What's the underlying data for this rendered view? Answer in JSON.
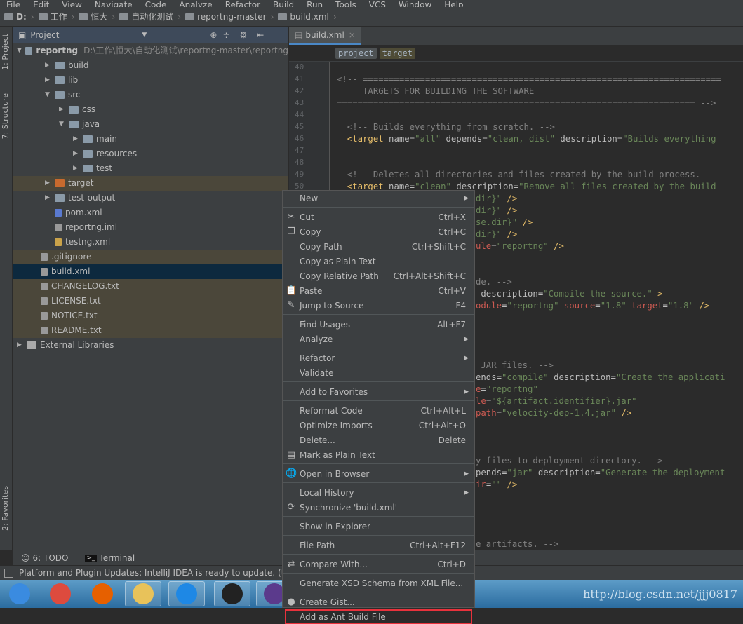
{
  "menubar": [
    "File",
    "Edit",
    "View",
    "Navigate",
    "Code",
    "Analyze",
    "Refactor",
    "Build",
    "Run",
    "Tools",
    "VCS",
    "Window",
    "Help"
  ],
  "breadcrumbs": [
    "D:",
    "工作",
    "恒大",
    "自动化测试",
    "reportng-master",
    "build.xml"
  ],
  "left_strip": {
    "project": "1: Project",
    "structure": "7: Structure",
    "favorites": "2: Favorites"
  },
  "project_panel": {
    "title": "Project",
    "root": {
      "name": "reportng",
      "path": "D:\\工作\\恒大\\自动化测试\\reportng-master\\reportng"
    },
    "items": [
      {
        "name": "build",
        "depth": 1,
        "type": "folder",
        "expanded": false
      },
      {
        "name": "lib",
        "depth": 1,
        "type": "folder",
        "expanded": false
      },
      {
        "name": "src",
        "depth": 1,
        "type": "folder",
        "expanded": true
      },
      {
        "name": "css",
        "depth": 2,
        "type": "folder",
        "expanded": false
      },
      {
        "name": "java",
        "depth": 2,
        "type": "folder",
        "expanded": true
      },
      {
        "name": "main",
        "depth": 3,
        "type": "folder",
        "expanded": false
      },
      {
        "name": "resources",
        "depth": 3,
        "type": "folder",
        "expanded": false
      },
      {
        "name": "test",
        "depth": 3,
        "type": "folder",
        "expanded": false
      },
      {
        "name": "target",
        "depth": 1,
        "type": "excluded",
        "expanded": false
      },
      {
        "name": "test-output",
        "depth": 1,
        "type": "folder",
        "expanded": false
      },
      {
        "name": "pom.xml",
        "depth": 1,
        "type": "maven"
      },
      {
        "name": "reportng.iml",
        "depth": 1,
        "type": "file"
      },
      {
        "name": "testng.xml",
        "depth": 1,
        "type": "xml"
      },
      {
        "name": ".gitignore",
        "depth": 0,
        "type": "file",
        "ignored": true
      },
      {
        "name": "build.xml",
        "depth": 0,
        "type": "file",
        "selected": true
      },
      {
        "name": "CHANGELOG.txt",
        "depth": 0,
        "type": "file",
        "ignored": true
      },
      {
        "name": "LICENSE.txt",
        "depth": 0,
        "type": "file",
        "ignored": true
      },
      {
        "name": "NOTICE.txt",
        "depth": 0,
        "type": "file",
        "ignored": true
      },
      {
        "name": "README.txt",
        "depth": 0,
        "type": "file",
        "ignored": true
      },
      {
        "name": "External Libraries",
        "depth": -1,
        "type": "library",
        "expanded": false
      }
    ]
  },
  "editor": {
    "tab": "build.xml",
    "crumbs": [
      "project",
      "target"
    ],
    "line_numbers": [
      "40",
      "41",
      "42",
      "43",
      "44",
      "45",
      "46",
      "47",
      "48",
      "49",
      "50"
    ],
    "lines": [
      [],
      [
        [
          "c",
          "<!-- ====================================================================="
        ]
      ],
      [
        [
          "c",
          "     TARGETS FOR BUILDING THE SOFTWARE"
        ]
      ],
      [
        [
          "c",
          "===================================================================== -->"
        ]
      ],
      [],
      [
        [
          "c",
          "  <!-- Builds everything from scratch. -->"
        ]
      ],
      [
        [
          "t",
          "  <target "
        ],
        [
          "a",
          "name="
        ],
        [
          "v",
          "\"all\" "
        ],
        [
          "a",
          "depends="
        ],
        [
          "v",
          "\"clean, dist\" "
        ],
        [
          "a",
          "description="
        ],
        [
          "v",
          "\"Builds everything"
        ]
      ],
      [],
      [],
      [
        [
          "c",
          "  <!-- Deletes all directories and files created by the build process. -"
        ]
      ],
      [
        [
          "t",
          "  <target "
        ],
        [
          "a",
          "name="
        ],
        [
          "v",
          "\"clean\" "
        ],
        [
          "a",
          "description="
        ],
        [
          "v",
          "\"Remove all files created by the build"
        ]
      ]
    ],
    "hidden_fragments": [
      [
        [
          "v",
          "dir}\" "
        ],
        [
          "t",
          "/>"
        ]
      ],
      [
        [
          "v",
          "dir}\" "
        ],
        [
          "t",
          "/>"
        ]
      ],
      [
        [
          "v",
          "se.dir}\" "
        ],
        [
          "t",
          "/>"
        ]
      ],
      [
        [
          "v",
          "dir}\" "
        ],
        [
          "t",
          "/>"
        ]
      ],
      [
        [
          "e",
          "ule"
        ],
        [
          "a",
          "="
        ],
        [
          "v",
          "\"reportng\" "
        ],
        [
          "t",
          "/>"
        ]
      ],
      [],
      [],
      [
        [
          "c",
          "de. -->"
        ]
      ],
      [
        [
          "a",
          " description="
        ],
        [
          "v",
          "\"Compile the source.\" "
        ],
        [
          "t",
          ">"
        ]
      ],
      [
        [
          "e",
          "odule"
        ],
        [
          "a",
          "="
        ],
        [
          "v",
          "\"reportng\" "
        ],
        [
          "e",
          "source"
        ],
        [
          "a",
          "="
        ],
        [
          "v",
          "\"1.8\" "
        ],
        [
          "e",
          "target"
        ],
        [
          "a",
          "="
        ],
        [
          "v",
          "\"1.8\" "
        ],
        [
          "t",
          "/>"
        ]
      ],
      [],
      [],
      [],
      [],
      [
        [
          "c",
          " JAR files. -->"
        ]
      ],
      [
        [
          "a",
          "ends="
        ],
        [
          "v",
          "\"compile\" "
        ],
        [
          "a",
          "description="
        ],
        [
          "v",
          "\"Create the applicati"
        ]
      ],
      [
        [
          "e",
          "e"
        ],
        [
          "a",
          "="
        ],
        [
          "v",
          "\"reportng\""
        ]
      ],
      [
        [
          "e",
          "le"
        ],
        [
          "a",
          "="
        ],
        [
          "v",
          "\"${artifact.identifier}.jar\""
        ]
      ],
      [
        [
          "e",
          "path"
        ],
        [
          "a",
          "="
        ],
        [
          "v",
          "\"velocity-dep-1.4.jar\" "
        ],
        [
          "t",
          "/>"
        ]
      ],
      [],
      [],
      [],
      [
        [
          "c",
          "y files to deployment directory. -->"
        ]
      ],
      [
        [
          "a",
          "pends="
        ],
        [
          "v",
          "\"jar\" "
        ],
        [
          "a",
          "description="
        ],
        [
          "v",
          "\"Generate the deployment"
        ]
      ],
      [
        [
          "e",
          "ir"
        ],
        [
          "a",
          "="
        ],
        [
          "v",
          "\"\" "
        ],
        [
          "t",
          "/>"
        ]
      ],
      [],
      [],
      [],
      [],
      [
        [
          "c",
          "e artifacts. -->"
        ]
      ]
    ]
  },
  "context_menu": [
    {
      "label": "New",
      "submenu": true
    },
    {
      "sep": true
    },
    {
      "label": "Cut",
      "shortcut": "Ctrl+X",
      "icon": "scissors-icon",
      "glyph": "✂"
    },
    {
      "label": "Copy",
      "shortcut": "Ctrl+C",
      "icon": "copy-icon",
      "glyph": "❐"
    },
    {
      "label": "Copy Path",
      "shortcut": "Ctrl+Shift+C"
    },
    {
      "label": "Copy as Plain Text"
    },
    {
      "label": "Copy Relative Path",
      "shortcut": "Ctrl+Alt+Shift+C"
    },
    {
      "label": "Paste",
      "shortcut": "Ctrl+V",
      "icon": "paste-icon",
      "glyph": "📋"
    },
    {
      "label": "Jump to Source",
      "shortcut": "F4",
      "icon": "jump-to-source-icon",
      "glyph": "✎"
    },
    {
      "sep": true
    },
    {
      "label": "Find Usages",
      "shortcut": "Alt+F7"
    },
    {
      "label": "Analyze",
      "submenu": true
    },
    {
      "sep": true
    },
    {
      "label": "Refactor",
      "submenu": true
    },
    {
      "label": "Validate"
    },
    {
      "sep": true
    },
    {
      "label": "Add to Favorites",
      "submenu": true
    },
    {
      "sep": true
    },
    {
      "label": "Reformat Code",
      "shortcut": "Ctrl+Alt+L"
    },
    {
      "label": "Optimize Imports",
      "shortcut": "Ctrl+Alt+O"
    },
    {
      "label": "Delete...",
      "shortcut": "Delete"
    },
    {
      "label": "Mark as Plain Text",
      "icon": "plain-text-icon",
      "glyph": "▤"
    },
    {
      "sep": true
    },
    {
      "label": "Open in Browser",
      "submenu": true,
      "icon": "globe-icon",
      "glyph": "🌐"
    },
    {
      "sep": true
    },
    {
      "label": "Local History",
      "submenu": true
    },
    {
      "label": "Synchronize 'build.xml'",
      "icon": "sync-icon",
      "glyph": "⟳"
    },
    {
      "sep": true
    },
    {
      "label": "Show in Explorer"
    },
    {
      "sep": true
    },
    {
      "label": "File Path",
      "shortcut": "Ctrl+Alt+F12"
    },
    {
      "sep": true
    },
    {
      "label": "Compare With...",
      "shortcut": "Ctrl+D",
      "icon": "compare-icon",
      "glyph": "⇄"
    },
    {
      "sep": true
    },
    {
      "label": "Generate XSD Schema from XML File..."
    },
    {
      "sep": true
    },
    {
      "label": "Create Gist...",
      "icon": "github-icon",
      "glyph": "●"
    },
    {
      "label": "Add as Ant Build File",
      "highlighted": true
    }
  ],
  "bottom_tools": {
    "todo": "6: TODO",
    "terminal": "Terminal"
  },
  "status": "Platform and Plugin Updates: IntelliJ IDEA is ready to update. (to",
  "taskbar": [
    "start",
    "chrome",
    "firefox",
    "explorer",
    "sogou",
    "nox",
    "eclipse"
  ],
  "watermark": "http://blog.csdn.net/jjj0817",
  "colors": {
    "highlight_box": "#e8323c",
    "selection": "#0d293e",
    "folder": "#8a8f94",
    "tab_underline": "#4a88c7"
  }
}
